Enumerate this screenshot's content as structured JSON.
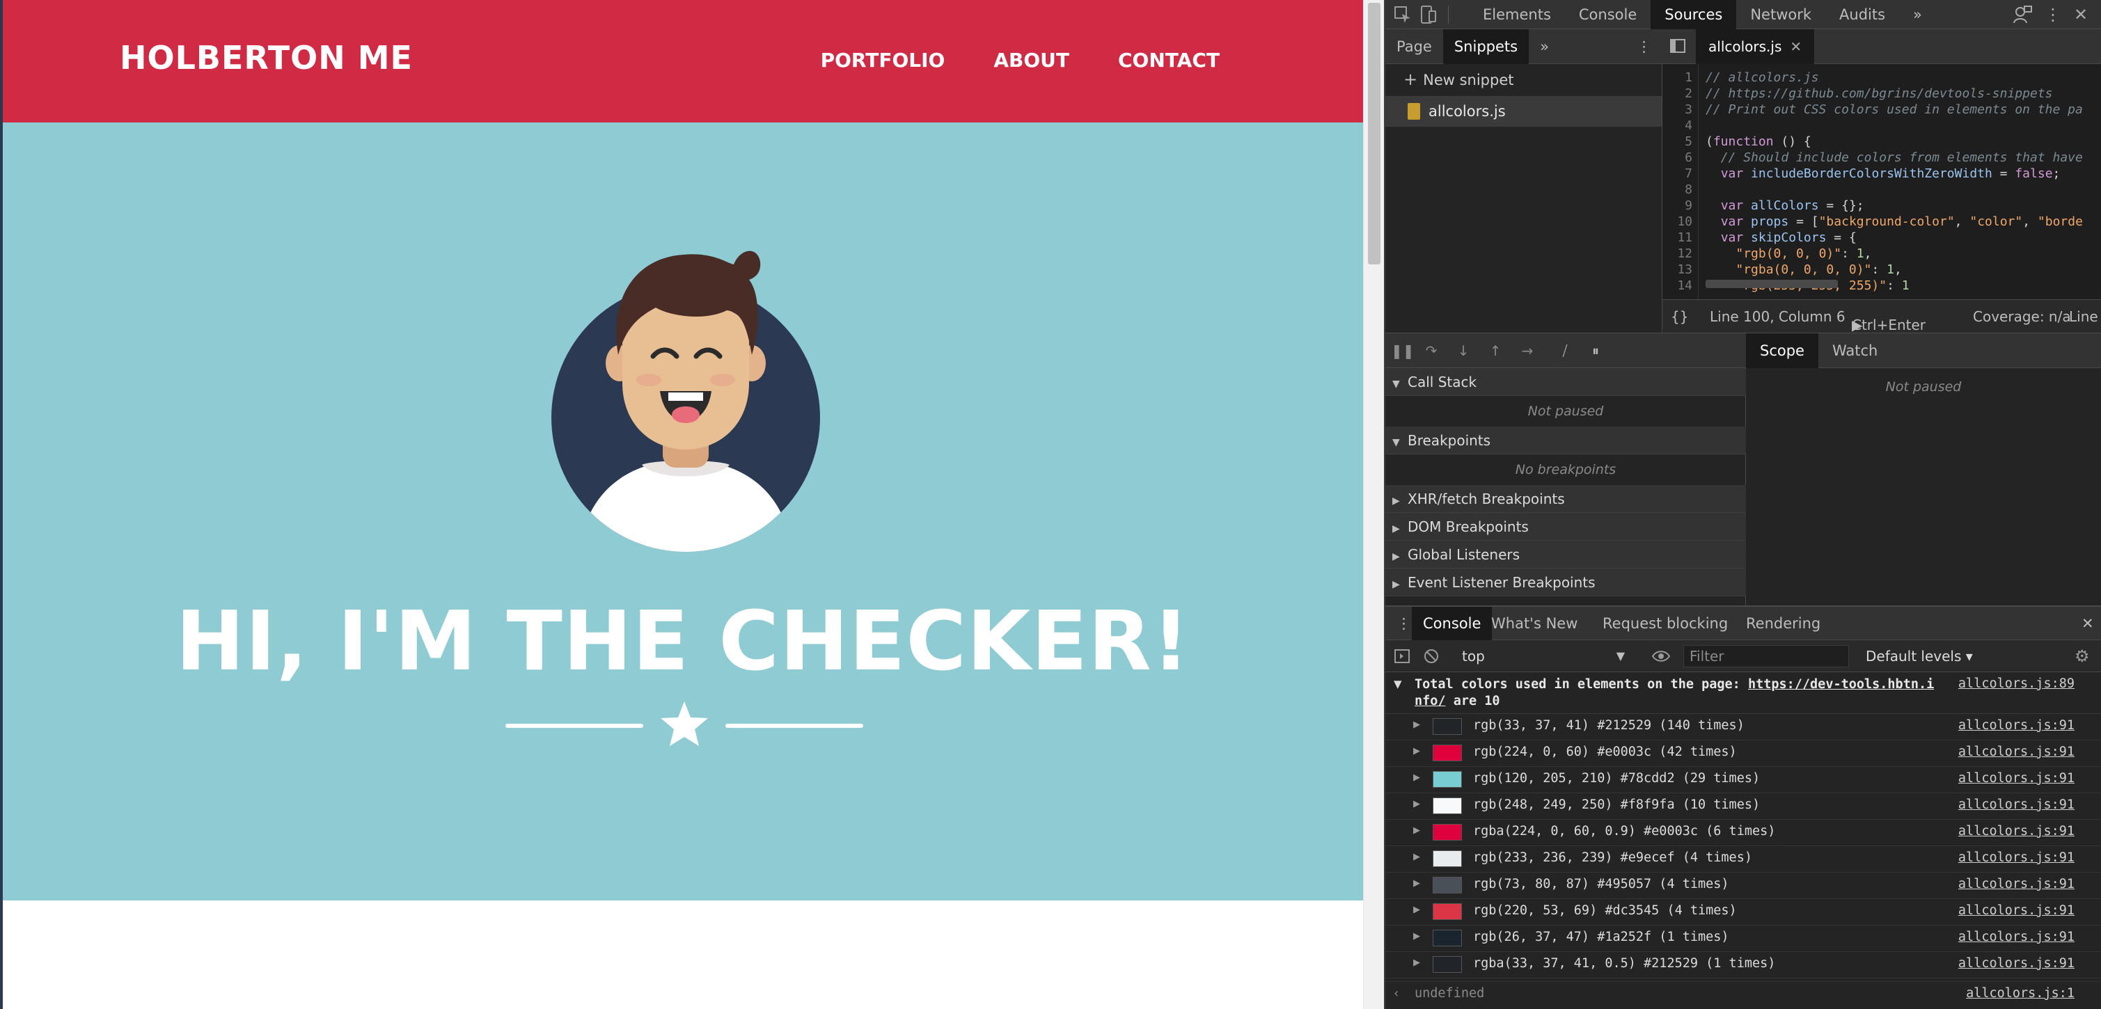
{
  "website": {
    "brand": "HOLBERTON ME",
    "nav": [
      "PORTFOLIO",
      "ABOUT",
      "CONTACT"
    ],
    "hero_title": "HI, I'M THE CHECKER!",
    "colors": {
      "nav_bg": "#d02a44",
      "hero_bg": "#8fcbd3",
      "avatar_circle": "#2b3a52",
      "text": "#ffffff"
    }
  },
  "devtools": {
    "main_tabs": [
      "Elements",
      "Console",
      "Sources",
      "Network",
      "Audits"
    ],
    "active_main_tab": "Sources",
    "overflow_icon": "»",
    "navigator": {
      "tabs": [
        "Page",
        "Snippets"
      ],
      "active_tab": "Snippets",
      "new_snippet_label": "New snippet",
      "snippet_file": "allcolors.js"
    },
    "editor": {
      "tab_label": "allcolors.js",
      "line_numbers": [
        "1",
        "2",
        "3",
        "4",
        "5",
        "6",
        "7",
        "8",
        "9",
        "10",
        "11",
        "12",
        "13",
        "14"
      ],
      "status": {
        "position": "Line 100, Column 6",
        "run": "Ctrl+Enter",
        "coverage": "Coverage: n/a",
        "line_label": "Line"
      }
    },
    "debugger": {
      "sections": [
        "Call Stack",
        "Breakpoints",
        "XHR/fetch Breakpoints",
        "DOM Breakpoints",
        "Global Listeners",
        "Event Listener Breakpoints"
      ],
      "call_stack_empty": "Not paused",
      "breakpoints_empty": "No breakpoints",
      "scope_tabs": [
        "Scope",
        "Watch"
      ],
      "scope_empty": "Not paused"
    },
    "drawer": {
      "tabs": [
        "Console",
        "What's New",
        "Request blocking",
        "Rendering"
      ],
      "active_tab": "Console",
      "context": "top",
      "filter_placeholder": "Filter",
      "levels": "Default levels"
    },
    "console": {
      "summary_line1": "Total colors used in elements on the page: ",
      "summary_url_part1": "https://dev-tools.hbtn.i",
      "summary_url_part2": "nfo/",
      "summary_line2_rest": " are 10",
      "summary_source": "allcolors.js:89",
      "rows": [
        {
          "swatch": "#212529",
          "text": "rgb(33, 37, 41) #212529 (140 times)",
          "source": "allcolors.js:91"
        },
        {
          "swatch": "#e0003c",
          "text": "rgb(224, 0, 60) #e0003c (42 times)",
          "source": "allcolors.js:91"
        },
        {
          "swatch": "#78cdd2",
          "text": "rgb(120, 205, 210) #78cdd2 (29 times)",
          "source": "allcolors.js:91"
        },
        {
          "swatch": "#f8f9fa",
          "text": "rgb(248, 249, 250) #f8f9fa (10 times)",
          "source": "allcolors.js:91"
        },
        {
          "swatch": "#e0003c",
          "text": "rgba(224, 0, 60, 0.9) #e0003c (6 times)",
          "source": "allcolors.js:91"
        },
        {
          "swatch": "#e9ecef",
          "text": "rgb(233, 236, 239) #e9ecef (4 times)",
          "source": "allcolors.js:91"
        },
        {
          "swatch": "#495057",
          "text": "rgb(73, 80, 87) #495057 (4 times)",
          "source": "allcolors.js:91"
        },
        {
          "swatch": "#dc3545",
          "text": "rgb(220, 53, 69) #dc3545 (4 times)",
          "source": "allcolors.js:91"
        },
        {
          "swatch": "#1a252f",
          "text": "rgb(26, 37, 47) #1a252f (1 times)",
          "source": "allcolors.js:91"
        },
        {
          "swatch": "#212529",
          "text": "rgba(33, 37, 41, 0.5) #212529 (1 times)",
          "source": "allcolors.js:91"
        }
      ],
      "return_value": "undefined",
      "return_source": "allcolors.js:1"
    }
  }
}
